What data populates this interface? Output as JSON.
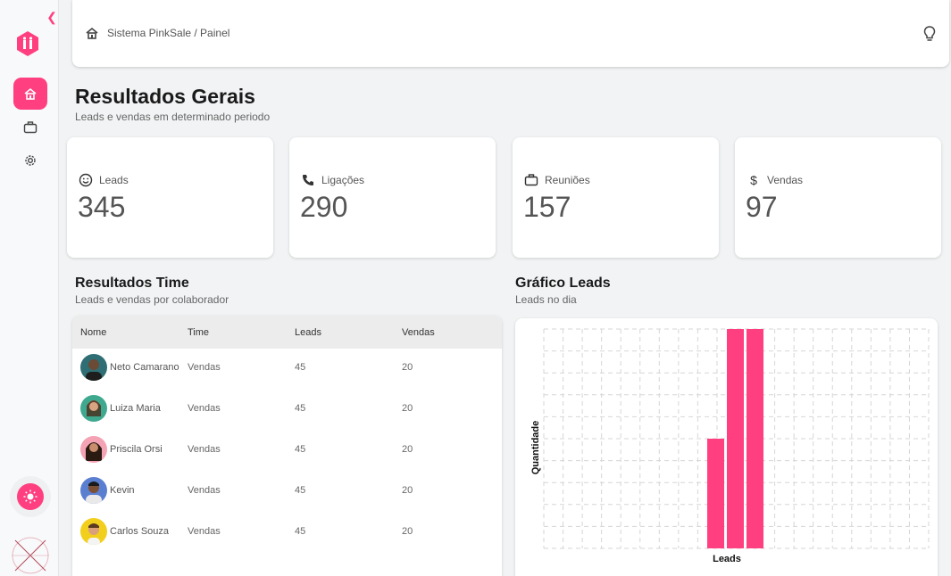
{
  "breadcrumb": "Sistema PinkSale / Painel",
  "title": "Resultados Gerais",
  "subtitle": "Leads e vendas em determinado periodo",
  "stats": [
    {
      "label": "Leads",
      "value": "345",
      "icon": "smiley-icon"
    },
    {
      "label": "Ligações",
      "value": "290",
      "icon": "phone-icon"
    },
    {
      "label": "Reuniões",
      "value": "157",
      "icon": "briefcase-icon"
    },
    {
      "label": "Vendas",
      "value": "97",
      "icon": "dollar-icon"
    }
  ],
  "team": {
    "title": "Resultados Time",
    "subtitle": "Leads e vendas por colaborador",
    "columns": [
      "Nome",
      "Time",
      "Leads",
      "Vendas"
    ],
    "rows": [
      {
        "name": "Neto Camarano",
        "team": "Vendas",
        "leads": "45",
        "sales": "20"
      },
      {
        "name": "Luiza Maria",
        "team": "Vendas",
        "leads": "45",
        "sales": "20"
      },
      {
        "name": "Priscila Orsi",
        "team": "Vendas",
        "leads": "45",
        "sales": "20"
      },
      {
        "name": "Kevin",
        "team": "Vendas",
        "leads": "45",
        "sales": "20"
      },
      {
        "name": "Carlos Souza",
        "team": "Vendas",
        "leads": "45",
        "sales": "20"
      }
    ]
  },
  "chart_section": {
    "title": "Gráfico Leads",
    "subtitle": "Leads no dia"
  },
  "colors": {
    "accent": "#ff3f7f"
  },
  "chart_data": {
    "type": "bar",
    "xlabel": "Leads",
    "ylabel": "Quantidade",
    "grid": true,
    "legend": "none",
    "ylim": [
      0,
      10
    ],
    "values": [
      5,
      10,
      10
    ]
  }
}
